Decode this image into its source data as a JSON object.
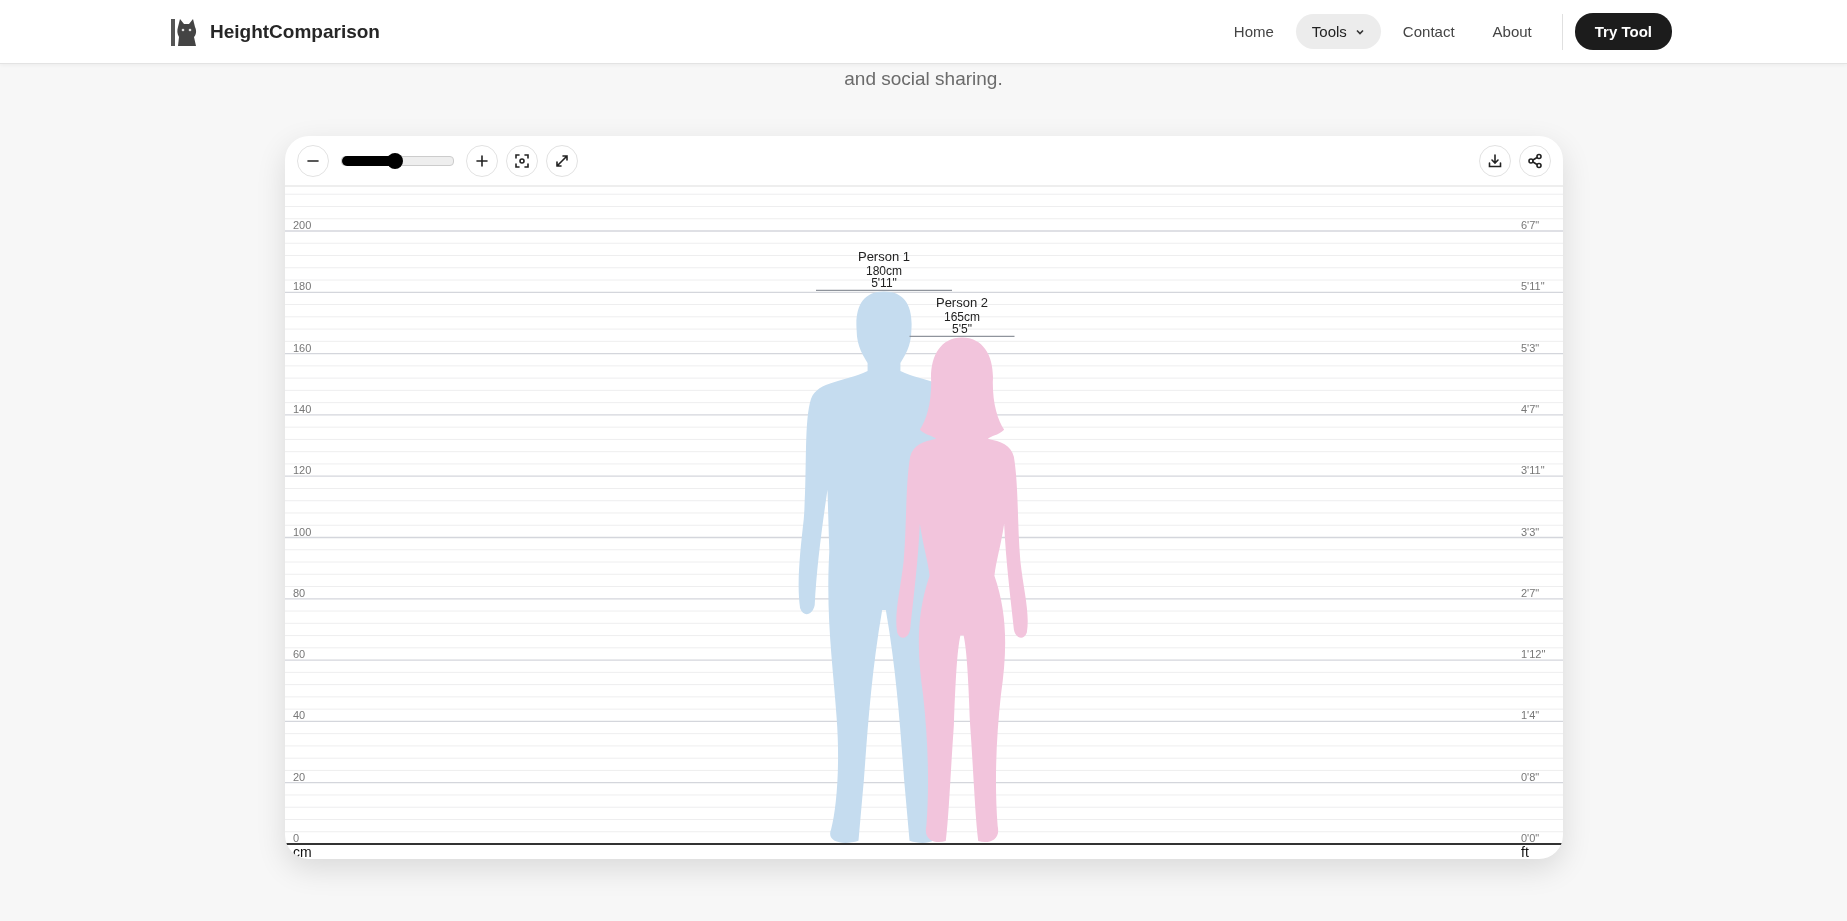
{
  "header": {
    "brand": "HeightComparison",
    "nav": [
      {
        "label": "Home",
        "selected": false,
        "has_menu": false
      },
      {
        "label": "Tools",
        "selected": true,
        "has_menu": true
      },
      {
        "label": "Contact",
        "selected": false,
        "has_menu": false
      },
      {
        "label": "About",
        "selected": false,
        "has_menu": false
      }
    ],
    "cta": "Try Tool"
  },
  "intro": "and social sharing.",
  "card": {
    "zoom": {
      "level": 0.48
    },
    "left_axis": {
      "ticks": [
        "200",
        "180",
        "160",
        "140",
        "120",
        "100",
        "80",
        "60",
        "40",
        "20",
        "0"
      ],
      "unit": "cm"
    },
    "right_axis": {
      "ticks": [
        "6'7\"",
        "5'11\"",
        "5'3\"",
        "4'7\"",
        "3'11\"",
        "3'3\"",
        "2'7\"",
        "1'12\"",
        "1'4\"",
        "0'8\"",
        "0'0\""
      ],
      "unit": "ft"
    },
    "people": [
      {
        "kind": "male",
        "name": "Person 1",
        "metric": "180cm",
        "imperial": "5'11\"",
        "color": "#c5dcef"
      },
      {
        "kind": "female",
        "name": "Person 2",
        "metric": "165cm",
        "imperial": "5'5\"",
        "color": "#f2c4dc"
      }
    ]
  }
}
